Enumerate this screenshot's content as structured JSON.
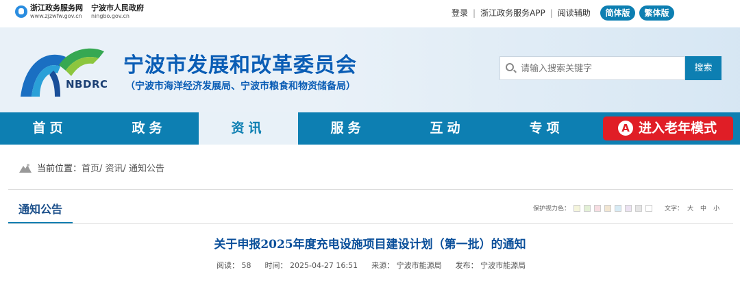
{
  "topbar": {
    "zj_logo_cn": "浙江政务服务网",
    "zj_logo_en": "www.zjzwfw.gov.cn",
    "nb_logo_cn": "宁波市人民政府",
    "nb_logo_en": "ningbo.gov.cn",
    "login": "登录",
    "app": "浙江政务服务APP",
    "reading_aid": "阅读辅助",
    "simplified": "简体版",
    "traditional": "繁体版"
  },
  "header": {
    "logo_abbr": "NBDRC",
    "title": "宁波市发展和改革委员会",
    "subtitle": "（宁波市海洋经济发展局、宁波市粮食和物资储备局）",
    "search_placeholder": "请输入搜索关键字",
    "search_button": "搜索"
  },
  "nav": {
    "items": [
      {
        "label": "首页"
      },
      {
        "label": "政务"
      },
      {
        "label": "资讯",
        "active": true
      },
      {
        "label": "服务"
      },
      {
        "label": "互动"
      },
      {
        "label": "专项"
      }
    ],
    "elder_mode": "进入老年模式",
    "elder_icon_letter": "A"
  },
  "breadcrumb": {
    "label": "当前位置：",
    "path": "首页/ 资讯/ 通知公告"
  },
  "section": {
    "title": "通知公告",
    "eye_color_label": "保护视力色：",
    "eye_colors": [
      "#f5f5dc",
      "#e3f0d6",
      "#f7dde2",
      "#f2e6d2",
      "#d7ebf5",
      "#ece2f2",
      "#e5e5e5",
      "#ffffff"
    ],
    "font_label": "文字：",
    "font_sizes": [
      "大",
      "中",
      "小"
    ]
  },
  "article": {
    "title": "关于申报2025年度充电设施项目建设计划（第一批）的通知",
    "reads": "阅读：  58",
    "time": "时间：  2025-04-27 16:51",
    "source": "来源：  宁波市能源局",
    "publisher": "发布：  宁波市能源局"
  }
}
